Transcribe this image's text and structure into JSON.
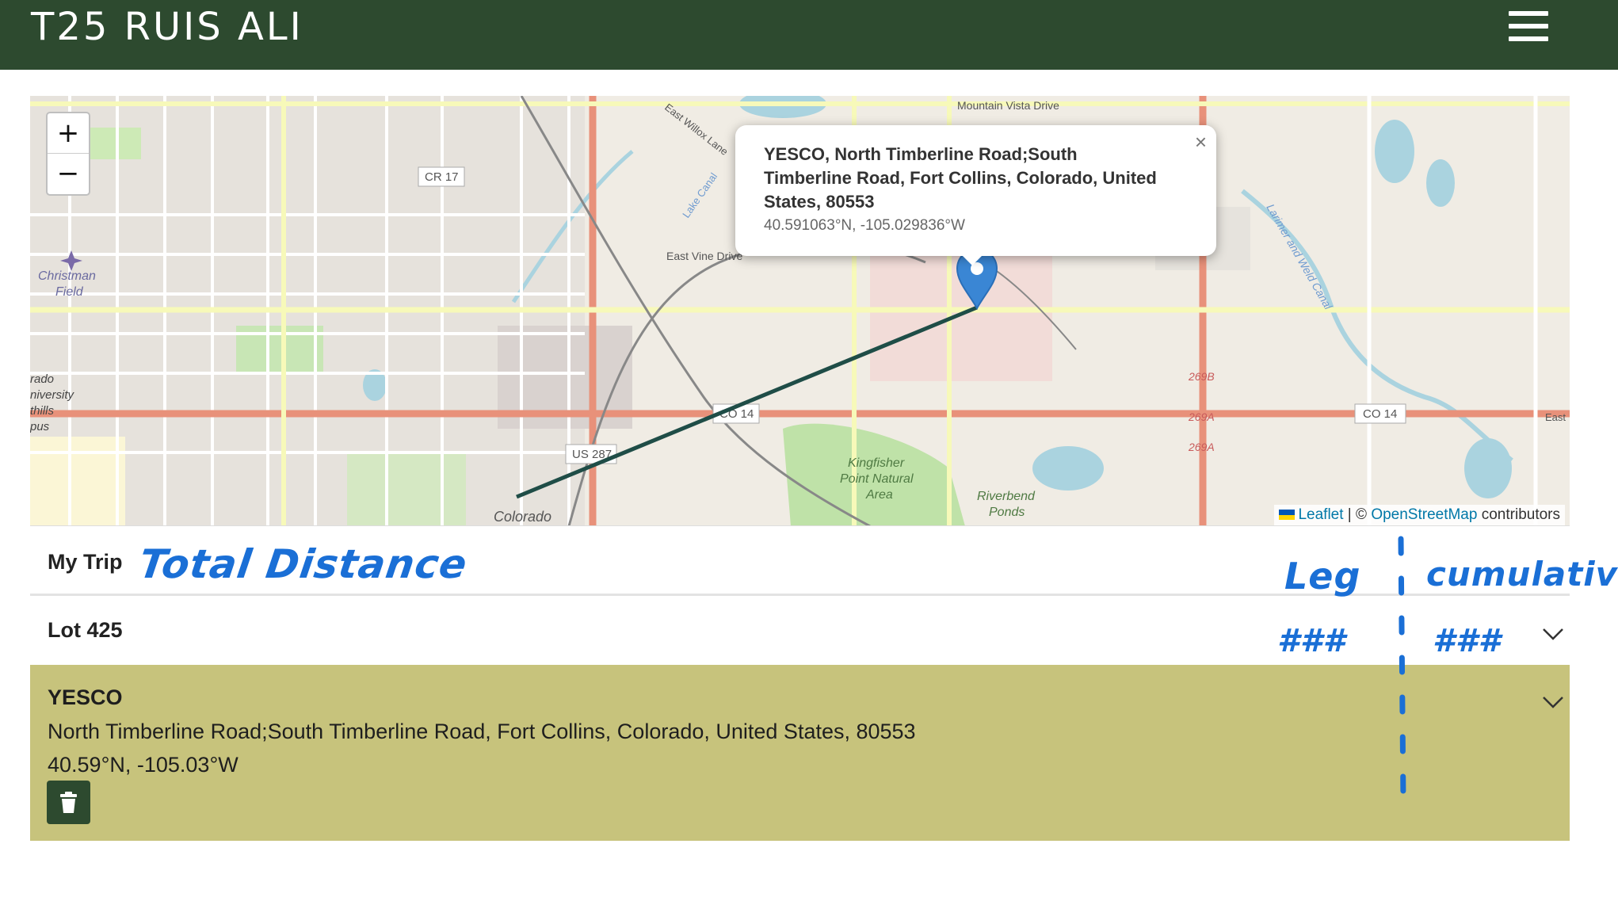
{
  "header": {
    "title": "T25 RUIS ALI",
    "menu_icon": "hamburger-menu-icon",
    "background_color": "#2d4a2f"
  },
  "map": {
    "zoom_in_label": "+",
    "zoom_out_label": "−",
    "labels": {
      "mountain_vista": "Mountain Vista Drive",
      "east_willox": "East Willox Lane",
      "cr17": "CR 17",
      "east_vine": "East Vine Drive",
      "lake_canal": "Lake Canal",
      "christman": "Christman",
      "field": "Field",
      "rado": "rado",
      "niversity": "niversity",
      "thills": "thills",
      "pus": "pus",
      "co14_left": "CO 14",
      "co14_right": "CO 14",
      "us287": "US 287",
      "colorado": "Colorado",
      "kingfisher1": "Kingfisher",
      "kingfisher2": "Point Natural",
      "kingfisher3": "Area",
      "riverbend1": "Riverbend",
      "riverbend2": "Ponds",
      "r269b": "269B",
      "r269a1": "269A",
      "r269a2": "269A",
      "larimer": "Larimer and Weld Canal",
      "east": "East"
    },
    "popup": {
      "title": "YESCO, North Timberline Road;South Timberline Road, Fort Collins, Colorado, United States, 80553",
      "title_line1": "YESCO, North Timberline Road;South",
      "title_line2": "Timberline Road, Fort Collins, Colorado, United",
      "title_line3": "States, 80553",
      "coords": "40.591063°N, -105.029836°W",
      "close_label": "×"
    },
    "marker_color": "#3a86d4",
    "route_color": "#1f4d47",
    "attribution": {
      "leaflet": "Leaflet",
      "separator": " | © ",
      "osm": "OpenStreetMap",
      "suffix": " contributors"
    }
  },
  "trip": {
    "title": "My Trip",
    "places": [
      {
        "name": "Lot 425",
        "expanded": false
      },
      {
        "name": "YESCO",
        "address": "North Timberline Road;South Timberline Road, Fort Collins, Colorado, United States, 80553",
        "coords": "40.59°N, -105.03°W",
        "highlight_color": "#c7c37c",
        "delete_icon": "trash-icon"
      }
    ]
  },
  "annotations": {
    "total_distance": "Total Distance",
    "leg": "Leg",
    "cumulative": "cumulative",
    "leg_value": "###",
    "cumulative_value": "###",
    "ink_color": "#1a6fd6"
  }
}
